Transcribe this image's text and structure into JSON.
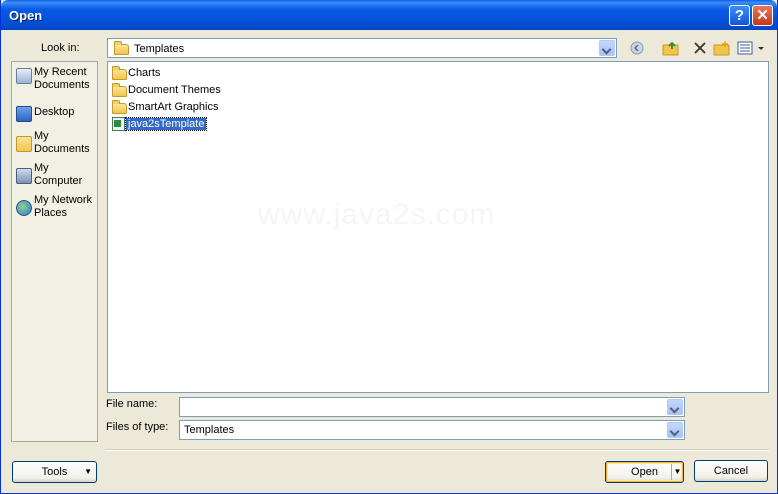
{
  "window": {
    "title": "Open",
    "help_label": "?",
    "close_label": "✕"
  },
  "toolbar": {
    "look_in_label": "Look in:",
    "look_in_value": "Templates",
    "icons": [
      "back-icon",
      "up-folder-icon",
      "delete-icon",
      "new-folder-icon",
      "views-icon"
    ]
  },
  "places": [
    {
      "label": "My Recent Documents",
      "icon": "recent-documents-icon"
    },
    {
      "label": "Desktop",
      "icon": "desktop-icon"
    },
    {
      "label": "My Documents",
      "icon": "my-documents-icon"
    },
    {
      "label": "My Computer",
      "icon": "my-computer-icon"
    },
    {
      "label": "My Network Places",
      "icon": "network-places-icon"
    }
  ],
  "files": [
    {
      "name": "Charts",
      "type": "folder"
    },
    {
      "name": "Document Themes",
      "type": "folder"
    },
    {
      "name": "SmartArt Graphics",
      "type": "folder"
    },
    {
      "name": "java2sTemplate",
      "type": "template",
      "selected": true
    }
  ],
  "watermark": "www.java2s.com",
  "fields": {
    "file_name_label": "File name:",
    "file_name_value": "",
    "file_type_label": "Files of type:",
    "file_type_value": "Templates"
  },
  "buttons": {
    "tools": "Tools",
    "open": "Open",
    "cancel": "Cancel"
  },
  "colors": {
    "title_bar": "#0450d9",
    "selection": "#316ac5",
    "dialog_bg": "#ece9d8"
  }
}
